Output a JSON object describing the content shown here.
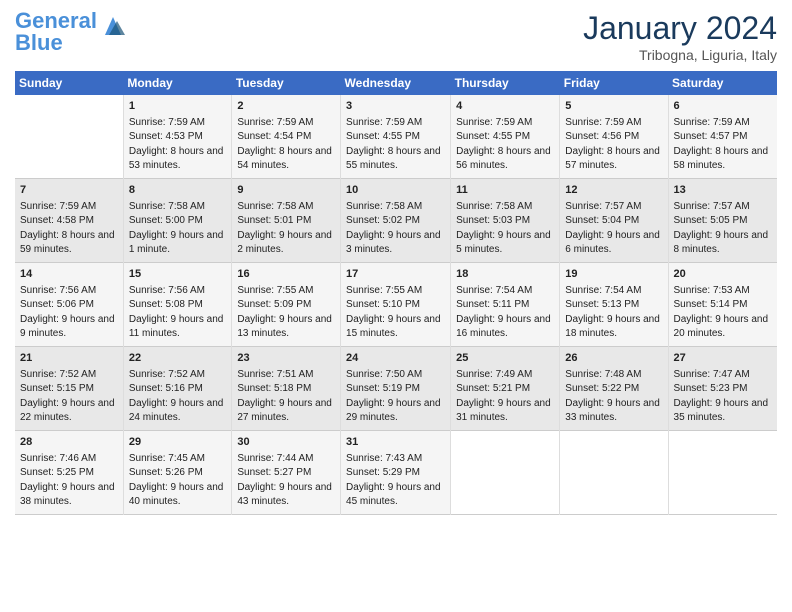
{
  "header": {
    "logo_line1": "General",
    "logo_line2": "Blue",
    "title": "January 2024",
    "subtitle": "Tribogna, Liguria, Italy"
  },
  "days_of_week": [
    "Sunday",
    "Monday",
    "Tuesday",
    "Wednesday",
    "Thursday",
    "Friday",
    "Saturday"
  ],
  "weeks": [
    [
      {
        "day": "",
        "sunrise": "",
        "sunset": "",
        "daylight": ""
      },
      {
        "day": "1",
        "sunrise": "Sunrise: 7:59 AM",
        "sunset": "Sunset: 4:53 PM",
        "daylight": "Daylight: 8 hours and 53 minutes."
      },
      {
        "day": "2",
        "sunrise": "Sunrise: 7:59 AM",
        "sunset": "Sunset: 4:54 PM",
        "daylight": "Daylight: 8 hours and 54 minutes."
      },
      {
        "day": "3",
        "sunrise": "Sunrise: 7:59 AM",
        "sunset": "Sunset: 4:55 PM",
        "daylight": "Daylight: 8 hours and 55 minutes."
      },
      {
        "day": "4",
        "sunrise": "Sunrise: 7:59 AM",
        "sunset": "Sunset: 4:55 PM",
        "daylight": "Daylight: 8 hours and 56 minutes."
      },
      {
        "day": "5",
        "sunrise": "Sunrise: 7:59 AM",
        "sunset": "Sunset: 4:56 PM",
        "daylight": "Daylight: 8 hours and 57 minutes."
      },
      {
        "day": "6",
        "sunrise": "Sunrise: 7:59 AM",
        "sunset": "Sunset: 4:57 PM",
        "daylight": "Daylight: 8 hours and 58 minutes."
      }
    ],
    [
      {
        "day": "7",
        "sunrise": "Sunrise: 7:59 AM",
        "sunset": "Sunset: 4:58 PM",
        "daylight": "Daylight: 8 hours and 59 minutes."
      },
      {
        "day": "8",
        "sunrise": "Sunrise: 7:58 AM",
        "sunset": "Sunset: 5:00 PM",
        "daylight": "Daylight: 9 hours and 1 minute."
      },
      {
        "day": "9",
        "sunrise": "Sunrise: 7:58 AM",
        "sunset": "Sunset: 5:01 PM",
        "daylight": "Daylight: 9 hours and 2 minutes."
      },
      {
        "day": "10",
        "sunrise": "Sunrise: 7:58 AM",
        "sunset": "Sunset: 5:02 PM",
        "daylight": "Daylight: 9 hours and 3 minutes."
      },
      {
        "day": "11",
        "sunrise": "Sunrise: 7:58 AM",
        "sunset": "Sunset: 5:03 PM",
        "daylight": "Daylight: 9 hours and 5 minutes."
      },
      {
        "day": "12",
        "sunrise": "Sunrise: 7:57 AM",
        "sunset": "Sunset: 5:04 PM",
        "daylight": "Daylight: 9 hours and 6 minutes."
      },
      {
        "day": "13",
        "sunrise": "Sunrise: 7:57 AM",
        "sunset": "Sunset: 5:05 PM",
        "daylight": "Daylight: 9 hours and 8 minutes."
      }
    ],
    [
      {
        "day": "14",
        "sunrise": "Sunrise: 7:56 AM",
        "sunset": "Sunset: 5:06 PM",
        "daylight": "Daylight: 9 hours and 9 minutes."
      },
      {
        "day": "15",
        "sunrise": "Sunrise: 7:56 AM",
        "sunset": "Sunset: 5:08 PM",
        "daylight": "Daylight: 9 hours and 11 minutes."
      },
      {
        "day": "16",
        "sunrise": "Sunrise: 7:55 AM",
        "sunset": "Sunset: 5:09 PM",
        "daylight": "Daylight: 9 hours and 13 minutes."
      },
      {
        "day": "17",
        "sunrise": "Sunrise: 7:55 AM",
        "sunset": "Sunset: 5:10 PM",
        "daylight": "Daylight: 9 hours and 15 minutes."
      },
      {
        "day": "18",
        "sunrise": "Sunrise: 7:54 AM",
        "sunset": "Sunset: 5:11 PM",
        "daylight": "Daylight: 9 hours and 16 minutes."
      },
      {
        "day": "19",
        "sunrise": "Sunrise: 7:54 AM",
        "sunset": "Sunset: 5:13 PM",
        "daylight": "Daylight: 9 hours and 18 minutes."
      },
      {
        "day": "20",
        "sunrise": "Sunrise: 7:53 AM",
        "sunset": "Sunset: 5:14 PM",
        "daylight": "Daylight: 9 hours and 20 minutes."
      }
    ],
    [
      {
        "day": "21",
        "sunrise": "Sunrise: 7:52 AM",
        "sunset": "Sunset: 5:15 PM",
        "daylight": "Daylight: 9 hours and 22 minutes."
      },
      {
        "day": "22",
        "sunrise": "Sunrise: 7:52 AM",
        "sunset": "Sunset: 5:16 PM",
        "daylight": "Daylight: 9 hours and 24 minutes."
      },
      {
        "day": "23",
        "sunrise": "Sunrise: 7:51 AM",
        "sunset": "Sunset: 5:18 PM",
        "daylight": "Daylight: 9 hours and 27 minutes."
      },
      {
        "day": "24",
        "sunrise": "Sunrise: 7:50 AM",
        "sunset": "Sunset: 5:19 PM",
        "daylight": "Daylight: 9 hours and 29 minutes."
      },
      {
        "day": "25",
        "sunrise": "Sunrise: 7:49 AM",
        "sunset": "Sunset: 5:21 PM",
        "daylight": "Daylight: 9 hours and 31 minutes."
      },
      {
        "day": "26",
        "sunrise": "Sunrise: 7:48 AM",
        "sunset": "Sunset: 5:22 PM",
        "daylight": "Daylight: 9 hours and 33 minutes."
      },
      {
        "day": "27",
        "sunrise": "Sunrise: 7:47 AM",
        "sunset": "Sunset: 5:23 PM",
        "daylight": "Daylight: 9 hours and 35 minutes."
      }
    ],
    [
      {
        "day": "28",
        "sunrise": "Sunrise: 7:46 AM",
        "sunset": "Sunset: 5:25 PM",
        "daylight": "Daylight: 9 hours and 38 minutes."
      },
      {
        "day": "29",
        "sunrise": "Sunrise: 7:45 AM",
        "sunset": "Sunset: 5:26 PM",
        "daylight": "Daylight: 9 hours and 40 minutes."
      },
      {
        "day": "30",
        "sunrise": "Sunrise: 7:44 AM",
        "sunset": "Sunset: 5:27 PM",
        "daylight": "Daylight: 9 hours and 43 minutes."
      },
      {
        "day": "31",
        "sunrise": "Sunrise: 7:43 AM",
        "sunset": "Sunset: 5:29 PM",
        "daylight": "Daylight: 9 hours and 45 minutes."
      },
      {
        "day": "",
        "sunrise": "",
        "sunset": "",
        "daylight": ""
      },
      {
        "day": "",
        "sunrise": "",
        "sunset": "",
        "daylight": ""
      },
      {
        "day": "",
        "sunrise": "",
        "sunset": "",
        "daylight": ""
      }
    ]
  ]
}
